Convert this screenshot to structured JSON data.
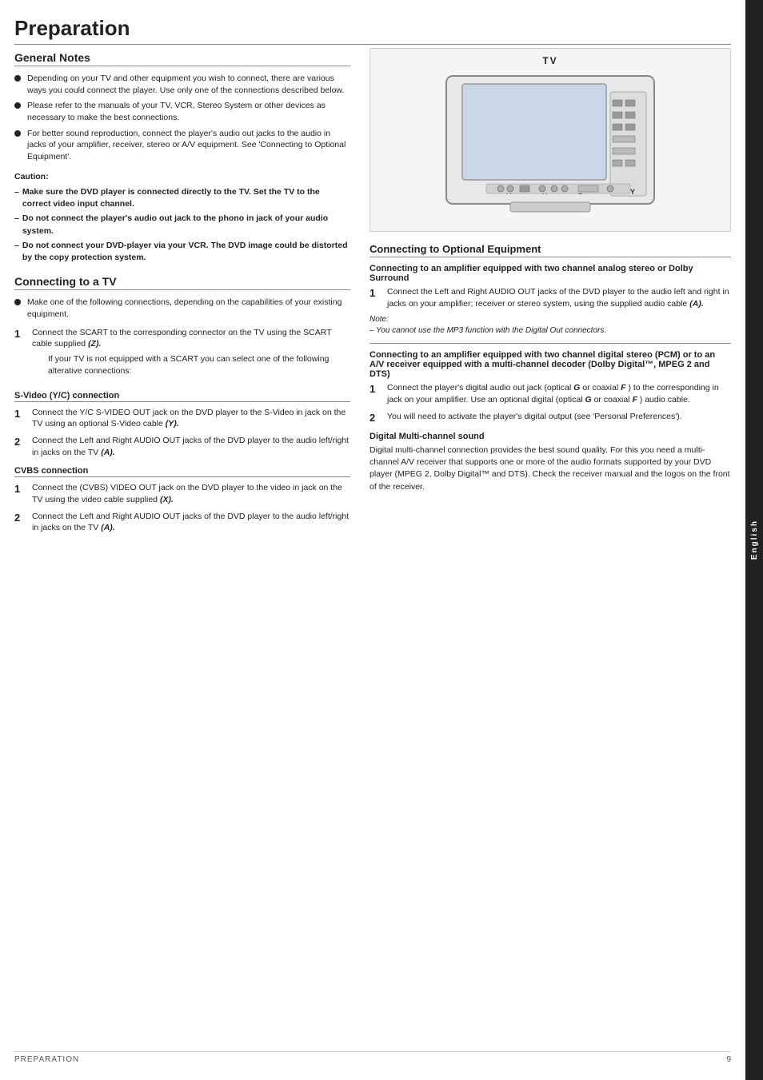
{
  "page": {
    "title": "Preparation",
    "footer_left": "Preparation",
    "footer_page": "9",
    "side_tab": "English"
  },
  "general_notes": {
    "heading": "General Notes",
    "bullets": [
      "Depending on your TV and other equipment you wish to connect, there are various ways you could connect the player. Use only one of the connections described below.",
      "Please refer to the manuals of your TV, VCR, Stereo System or other devices as necessary to make the best connections.",
      "For better sound reproduction, connect the player's audio out jacks to the audio in jacks of your amplifier, receiver, stereo or A/V equipment.  See 'Connecting to Optional Equipment'."
    ],
    "caution_title": "Caution:",
    "caution_lines": [
      "Make sure the DVD player is connected directly to the TV. Set the TV to the correct video input channel.",
      "Do not connect  the player's audio out jack to the phono in jack of your audio system.",
      "Do not connect your DVD-player via your VCR. The DVD image could be distorted by the copy protection system."
    ]
  },
  "connecting_tv": {
    "heading": "Connecting to a TV",
    "bullet": "Make one of the following connections, depending on the capabilities of your existing equipment.",
    "step1": "Connect the SCART to the corresponding connector on the TV using the SCART cable supplied",
    "step1_bold": "(Z).",
    "step1_note": "If your TV is not equipped with a SCART you can select one of the following alterative connections:",
    "svideo": {
      "heading": "S-Video (Y/C) connection",
      "step1": "Connect the Y/C S-VIDEO OUT jack on the DVD player to the S-Video in jack on the TV using an optional S-Video cable",
      "step1_bold": "(Y).",
      "step2": "Connect the Left and Right AUDIO OUT jacks of the DVD player to the audio left/right in jacks on the TV",
      "step2_bold": "(A)."
    },
    "cvbs": {
      "heading": "CVBS connection",
      "step1": "Connect the (CVBS) VIDEO OUT jack on the DVD player to the video in jack on the TV using the video cable supplied",
      "step1_bold": "(X).",
      "step2": "Connect the Left and Right AUDIO OUT jacks of the DVD player to the audio left/right in jacks on the TV",
      "step2_bold": "(A)."
    }
  },
  "tv_diagram": {
    "label": "TV"
  },
  "connecting_optional": {
    "heading": "Connecting to Optional Equipment",
    "amplifier_analog": {
      "heading": "Connecting to an amplifier equipped with two channel analog  stereo or Dolby Surround",
      "step1": "Connect the Left and Right AUDIO OUT jacks of the DVD player to the audio left and right in jacks on your amplifier; receiver or stereo system, using the supplied audio cable",
      "step1_bold": "(A).",
      "note_title": "Note:",
      "note_line": "–  You cannot use the MP3 function with the Digital Out connectors."
    },
    "amplifier_digital": {
      "heading": "Connecting to an amplifier equipped with two channel digital stereo (PCM) or to an A/V receiver equipped with a multi-channel decoder (Dolby Digital™, MPEG 2 and DTS)",
      "step1": "Connect the player's digital audio out jack (optical",
      "step1_g": "G",
      "step1_mid": "or coaxial",
      "step1_f": "F",
      "step1_end": ") to the corresponding in jack on your amplifier. Use an optional digital (optical",
      "step1_g2": "G",
      "step1_or": "or coaxial",
      "step1_f2": "F",
      "step1_fin": ") audio cable.",
      "step2": "You will need to activate the player's digital output (see 'Personal Preferences').",
      "digital_multi": {
        "heading": "Digital Multi-channel sound",
        "text": "Digital multi-channel connection provides the best sound quality. For this you need a multi-channel A/V receiver that supports one or more of the audio formats supported by your DVD player (MPEG 2, Dolby Digital™ and DTS). Check the receiver manual and the logos on the front of the receiver."
      }
    }
  }
}
